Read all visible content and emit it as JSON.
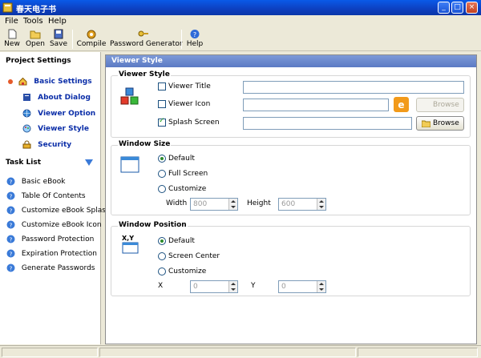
{
  "window": {
    "title": "春天电子书"
  },
  "menu": [
    "File",
    "Tools",
    "Help"
  ],
  "toolbar": {
    "new": "New",
    "open": "Open",
    "save": "Save",
    "compile": "Compile",
    "password_generator": "Password Generator",
    "help": "Help"
  },
  "sidebar": {
    "project_settings_title": "Project Settings",
    "project_items": [
      "Basic Settings",
      "About Dialog",
      "Viewer Option",
      "Viewer Style",
      "Security"
    ],
    "task_list_title": "Task List",
    "task_items": [
      "Basic eBook",
      "Table Of Contents",
      "Customize eBook Splash",
      "Customize eBook Icon",
      "Password Protection",
      "Expiration Protection",
      "Generate Passwords"
    ]
  },
  "panel": {
    "header": "Viewer Style",
    "viewer_style": {
      "title": "Viewer Style",
      "viewer_title_label": "Viewer Title",
      "viewer_icon_label": "Viewer Icon",
      "splash_screen_label": "Splash Screen",
      "viewer_title_checked": false,
      "viewer_icon_checked": false,
      "splash_screen_checked": true,
      "browse_label": "Browse"
    },
    "window_size": {
      "title": "Window Size",
      "options": [
        "Default",
        "Full Screen",
        "Customize"
      ],
      "selected": "Default",
      "width_label": "Width",
      "width_value": "800",
      "height_label": "Height",
      "height_value": "600"
    },
    "window_position": {
      "title": "Window Position",
      "options": [
        "Default",
        "Screen Center",
        "Customize"
      ],
      "selected": "Default",
      "x_label": "X",
      "x_value": "0",
      "y_label": "Y",
      "y_value": "0",
      "icon_text": "X,Y"
    }
  },
  "colors": {
    "title_bar": "#0d3fbf",
    "panel_header": "#6886cc",
    "selected_text": "#0b2ea8"
  }
}
